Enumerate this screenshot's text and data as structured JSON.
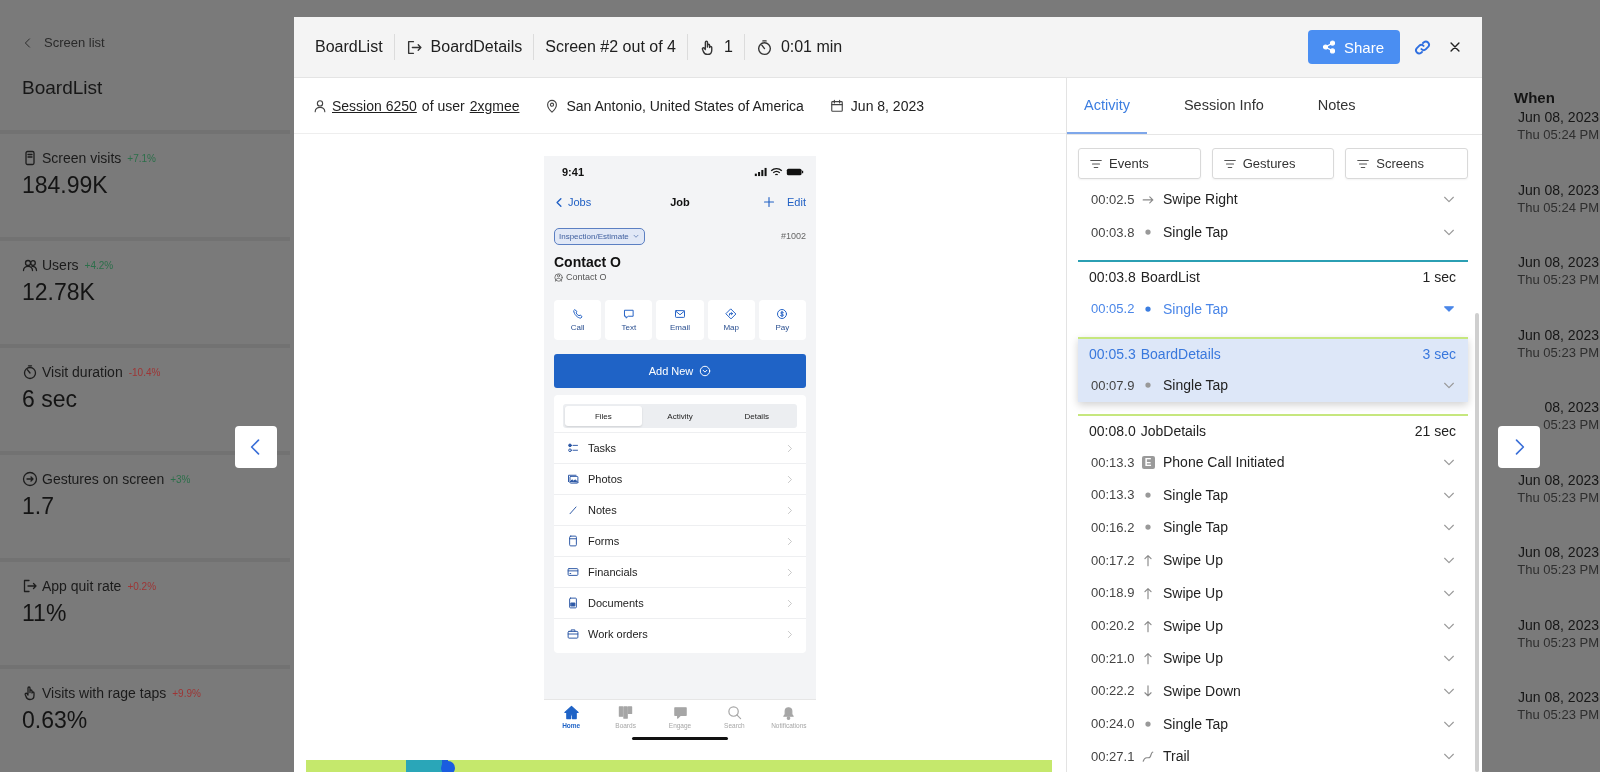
{
  "sidebar": {
    "back": "Screen list",
    "title": "BoardList",
    "metrics": [
      {
        "label": "Screen visits",
        "change": "+7.1%",
        "good": true,
        "value": "184.99K"
      },
      {
        "label": "Users",
        "change": "+4.2%",
        "good": true,
        "value": "12.78K"
      },
      {
        "label": "Visit duration",
        "change": "-10.4%",
        "good": false,
        "value": "6 sec"
      },
      {
        "label": "Gestures on screen",
        "change": "+3%",
        "good": true,
        "value": "1.7"
      },
      {
        "label": "App quit rate",
        "change": "+0.2%",
        "good": false,
        "value": "11%"
      },
      {
        "label": "Visits with rage taps",
        "change": "+9.9%",
        "good": false,
        "value": "0.63%"
      }
    ]
  },
  "header": {
    "screen": "BoardList",
    "next_screen": "BoardDetails",
    "position": "Screen #2 out of 4",
    "taps": "1",
    "duration": "0:01 min",
    "share": "Share"
  },
  "session": {
    "session": "Session 6250",
    "of_user": "of user",
    "user": "2xgmee",
    "location": "San Antonio, United States of America",
    "date": "Jun 8, 2023"
  },
  "phone": {
    "time": "9:41",
    "back": "Jobs",
    "title": "Job",
    "edit": "Edit",
    "status": "Inspection/Estimate",
    "number": "#1002",
    "contact": "Contact O",
    "contact_sub": "Contact O",
    "actions": [
      "Call",
      "Text",
      "Email",
      "Map",
      "Pay"
    ],
    "add": "Add New",
    "segments": [
      {
        "label": "Files",
        "selected": true
      },
      {
        "label": "Activity",
        "selected": false
      },
      {
        "label": "Details",
        "selected": false
      }
    ],
    "list": [
      "Tasks",
      "Photos",
      "Notes",
      "Forms",
      "Financials",
      "Documents",
      "Work orders"
    ],
    "tabbar": [
      {
        "label": "Home",
        "selected": true
      },
      {
        "label": "Boards",
        "selected": false
      },
      {
        "label": "Engage",
        "selected": false
      },
      {
        "label": "Search",
        "selected": false
      },
      {
        "label": "Notifications",
        "selected": false
      }
    ]
  },
  "timeline": {
    "level": 0.19
  },
  "activity": {
    "tabs": [
      {
        "label": "Activity",
        "selected": true
      },
      {
        "label": "Session Info",
        "selected": false
      },
      {
        "label": "Notes",
        "selected": false
      }
    ],
    "filters": [
      "Events",
      "Gestures",
      "Screens"
    ],
    "groups": [
      {
        "selected": false,
        "events": [
          {
            "time": "00:02.5",
            "kind": "swipe_right",
            "label": "Swipe Right",
            "active": false
          },
          {
            "time": "00:03.8",
            "kind": "tap",
            "label": "Single Tap",
            "active": false
          }
        ]
      },
      {
        "time": "00:03.8",
        "name": "BoardList",
        "duration": "1 sec",
        "color": "#2b9fb3",
        "selected": false,
        "events": [
          {
            "time": "00:05.2",
            "kind": "tap",
            "label": "Single Tap",
            "active": true
          }
        ]
      },
      {
        "time": "00:05.3",
        "name": "BoardDetails",
        "duration": "3 sec",
        "color": "#c6e77e",
        "selected": true,
        "events": [
          {
            "time": "00:07.9",
            "kind": "tap",
            "label": "Single Tap",
            "active": false
          }
        ]
      },
      {
        "time": "00:08.0",
        "name": "JobDetails",
        "duration": "21 sec",
        "color": "#c6e77e",
        "selected": false,
        "events": [
          {
            "time": "00:13.3",
            "kind": "event",
            "badge": "E",
            "label": "Phone Call Initiated",
            "active": false
          },
          {
            "time": "00:13.3",
            "kind": "tap",
            "label": "Single Tap",
            "active": false
          },
          {
            "time": "00:16.2",
            "kind": "tap",
            "label": "Single Tap",
            "active": false
          },
          {
            "time": "00:17.2",
            "kind": "swipe_up",
            "label": "Swipe Up",
            "active": false
          },
          {
            "time": "00:18.9",
            "kind": "swipe_up",
            "label": "Swipe Up",
            "active": false
          },
          {
            "time": "00:20.2",
            "kind": "swipe_up",
            "label": "Swipe Up",
            "active": false
          },
          {
            "time": "00:21.0",
            "kind": "swipe_up",
            "label": "Swipe Up",
            "active": false
          },
          {
            "time": "00:22.2",
            "kind": "swipe_down",
            "label": "Swipe Down",
            "active": false
          },
          {
            "time": "00:24.0",
            "kind": "tap",
            "label": "Single Tap",
            "active": false
          },
          {
            "time": "00:27.1",
            "kind": "trail",
            "label": "Trail",
            "active": false
          }
        ]
      }
    ]
  },
  "when": {
    "heading": "When",
    "rows": [
      {
        "date": "Jun 08, 2023",
        "time": "Thu 05:24 PM"
      },
      {
        "date": "Jun 08, 2023",
        "time": "Thu 05:24 PM"
      },
      {
        "date": "Jun 08, 2023",
        "time": "Thu 05:23 PM"
      },
      {
        "date": "Jun 08, 2023",
        "time": "Thu 05:23 PM"
      },
      {
        "date": "08, 2023",
        "time": "05:23 PM"
      },
      {
        "date": "Jun 08, 2023",
        "time": "Thu 05:23 PM"
      },
      {
        "date": "Jun 08, 2023",
        "time": "Thu 05:23 PM"
      },
      {
        "date": "Jun 08, 2023",
        "time": "Thu 05:23 PM"
      },
      {
        "date": "Jun 08, 2023",
        "time": "Thu 05:23 PM"
      }
    ]
  }
}
